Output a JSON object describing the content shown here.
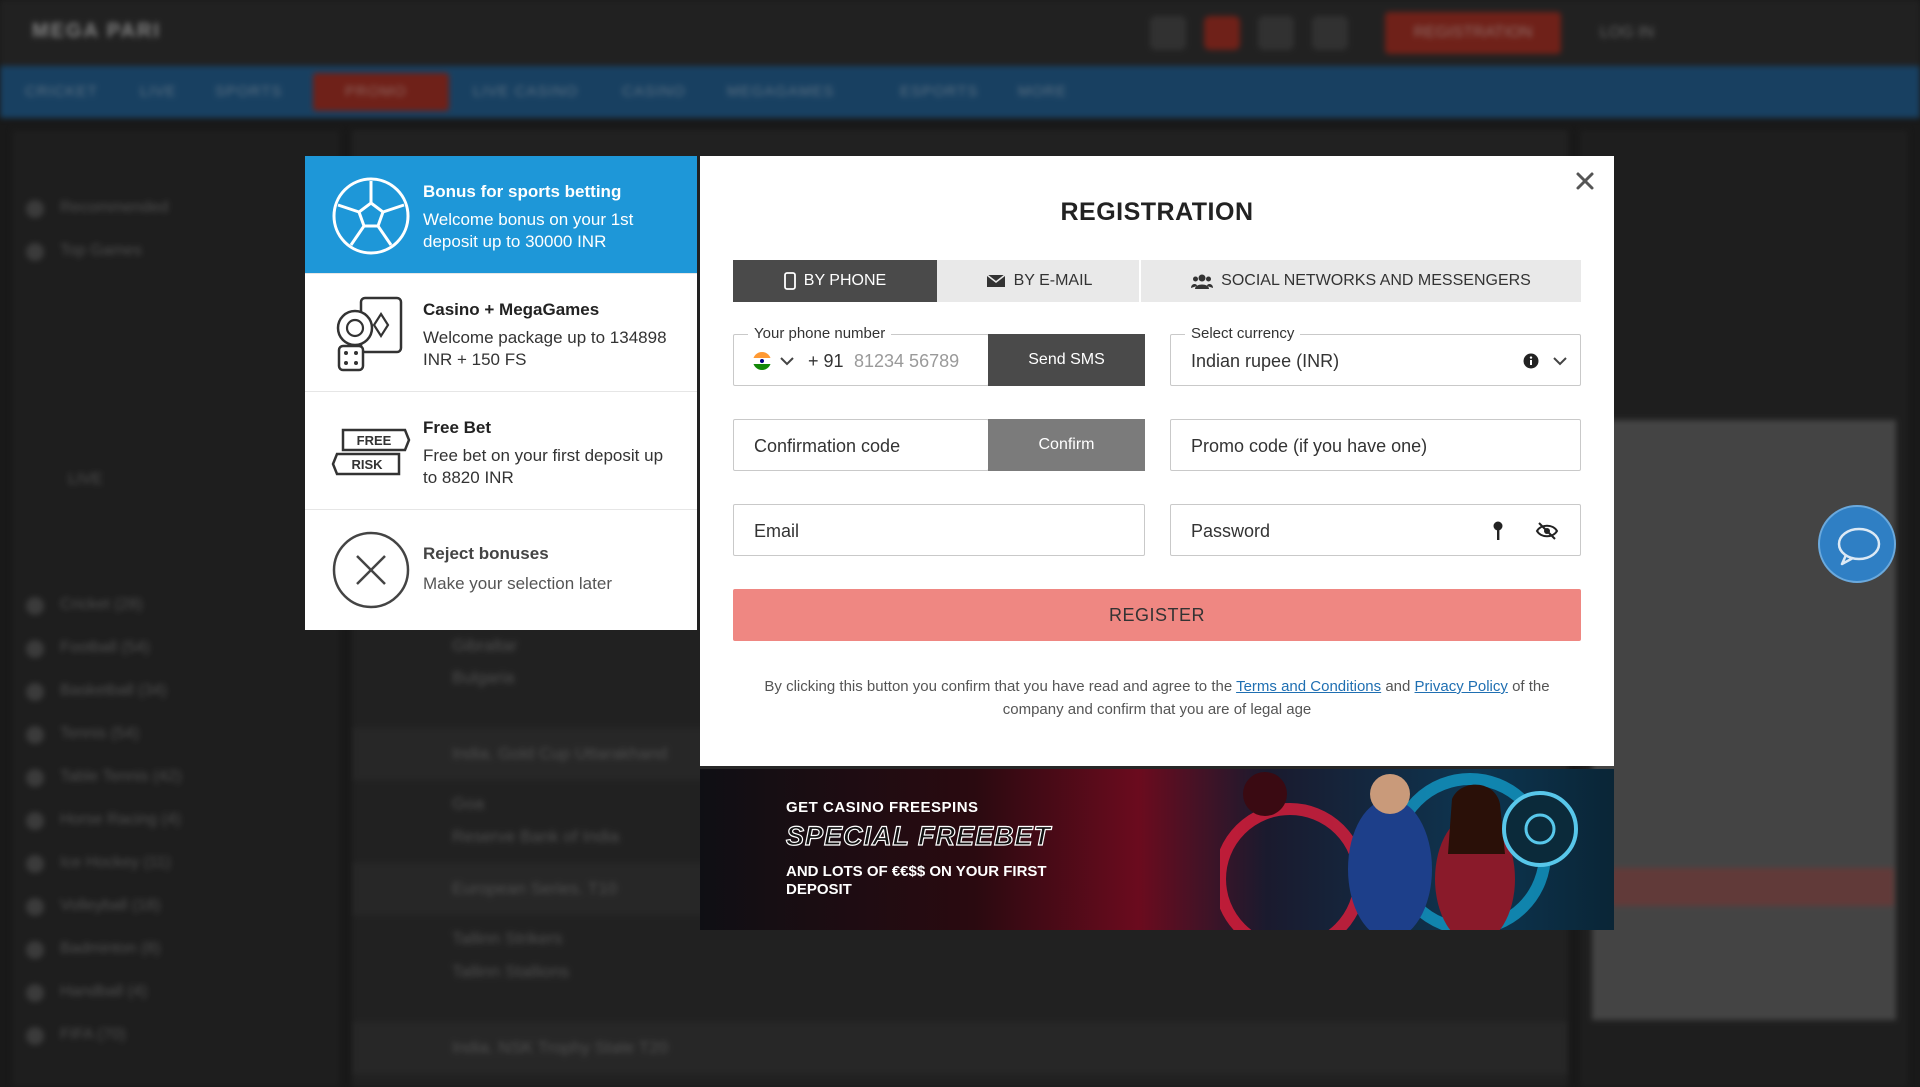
{
  "background": {
    "logo": "MEGA PARI",
    "top_register": "REGISTRATION",
    "top_login": "LOG IN",
    "nav_items": [
      "CRICKET",
      "LIVE",
      "SPORTS",
      "PROMO",
      "LIVE CASINO",
      "CASINO",
      "MEGAGAMES",
      "ESPORTS",
      "MORE"
    ],
    "left_items": [
      "Recommended",
      "Top Games",
      "LIVE",
      "Cricket (28)",
      "Football (54)",
      "Basketball (34)",
      "Tennis (54)",
      "Table Tennis (42)",
      "Horse Racing (4)",
      "Ice Hockey (11)",
      "Volleyball (18)",
      "Badminton (8)",
      "Handball (4)",
      "FIFA (70)"
    ],
    "center_rows": [
      "Gibraltar",
      "Bulgaria",
      "India. Gold Cup Uttarakhand",
      "Goa",
      "Reserve Bank of India",
      "European Series. T10",
      "Tallinn Strikers",
      "Tallinn Stallions",
      "India. NSK Trophy State T20"
    ]
  },
  "bonuses": [
    {
      "title": "Bonus for sports betting",
      "desc": "Welcome bonus on your 1st deposit up to 30000 INR",
      "icon": "soccer-ball-icon"
    },
    {
      "title": "Casino + MegaGames",
      "desc": "Welcome package up to 134898 INR + 150 FS",
      "icon": "casino-chips-cards-icon"
    },
    {
      "title": "Free Bet",
      "desc": "Free bet on your first deposit up to 8820 INR",
      "icon": "free-risk-ticket-icon",
      "ticket_top": "FREE",
      "ticket_bottom": "RISK"
    },
    {
      "title": "Reject bonuses",
      "desc": "Make your selection later",
      "icon": "reject-x-icon"
    }
  ],
  "modal": {
    "title": "REGISTRATION",
    "tabs": [
      "BY PHONE",
      "BY E-MAIL",
      "SOCIAL NETWORKS AND MESSENGERS"
    ],
    "phone_label": "Your phone number",
    "phone_code": "+ 91",
    "phone_placeholder": "81234 56789",
    "send_sms": "Send SMS",
    "currency_label": "Select currency",
    "currency_value": "Indian rupee (INR)",
    "confirmation_placeholder": "Confirmation code",
    "confirm_button": "Confirm",
    "promo_placeholder": "Promo code (if you have one)",
    "email_placeholder": "Email",
    "password_placeholder": "Password",
    "register_button": "REGISTER",
    "legal_prefix": "By clicking this button you confirm that you have read and agree to the",
    "legal_terms": "Terms and Conditions",
    "legal_and": "and",
    "legal_privacy": "Privacy Policy",
    "legal_suffix": "of the company and confirm that you are of legal age"
  },
  "banner": {
    "line1": "GET CASINO FREESPINS",
    "line2": "SPECIAL FREEBET",
    "line3": "AND LOTS OF €€$$ ON YOUR FIRST DEPOSIT"
  },
  "colors": {
    "accent_blue": "#1e97d8",
    "register_red": "#ef8782",
    "tab_dark": "#4a4a4a",
    "link_blue": "#1f6fb2"
  }
}
